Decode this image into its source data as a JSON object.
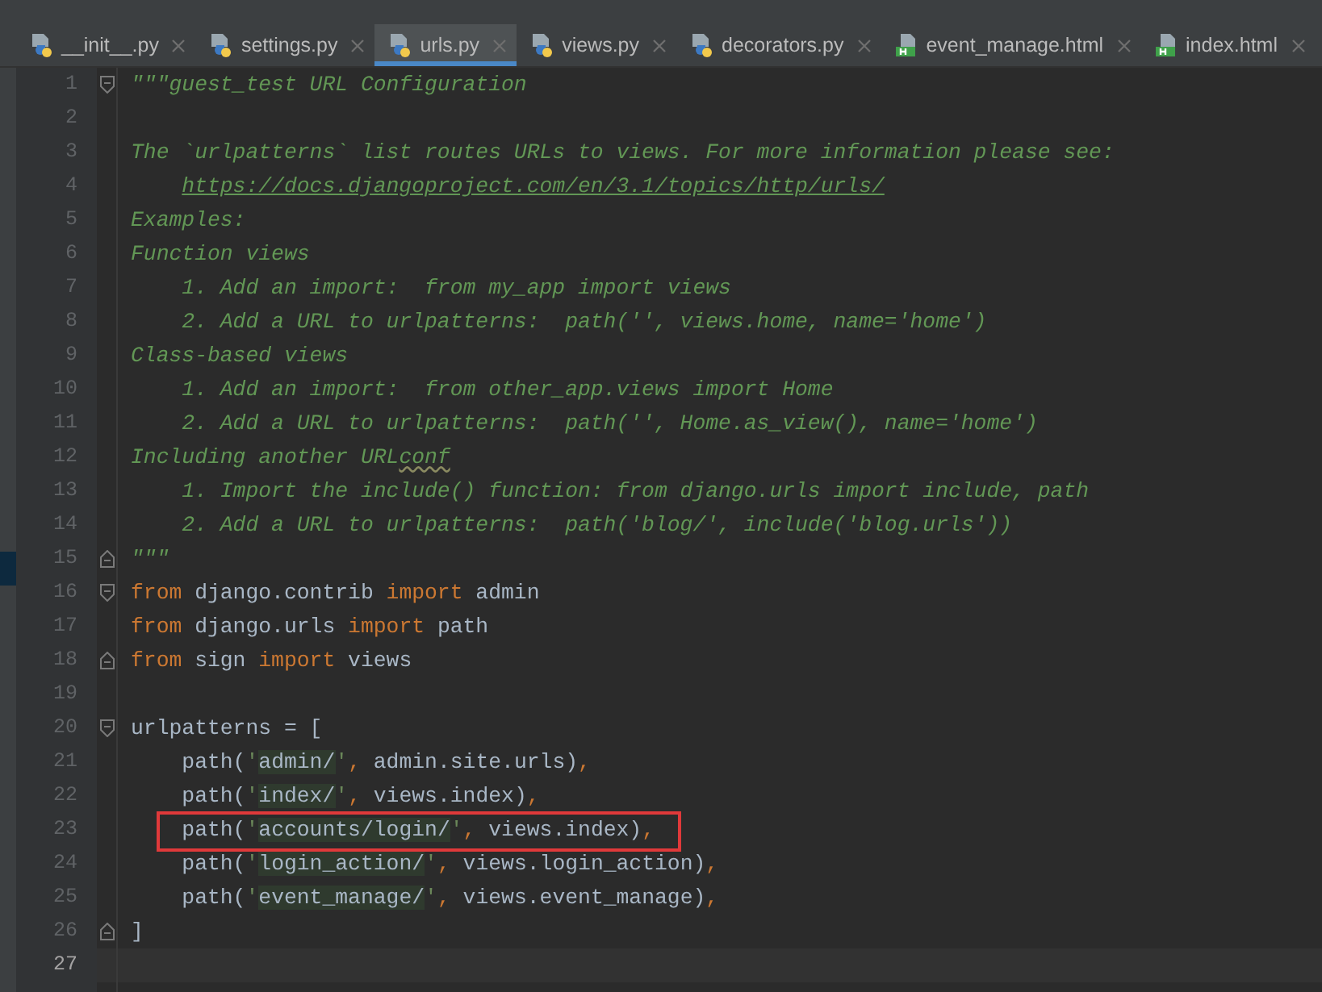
{
  "tabs": [
    {
      "label": "__init__.py",
      "kind": "python",
      "selected": false
    },
    {
      "label": "settings.py",
      "kind": "python",
      "selected": false
    },
    {
      "label": "urls.py",
      "kind": "python",
      "selected": true
    },
    {
      "label": "views.py",
      "kind": "python",
      "selected": false
    },
    {
      "label": "decorators.py",
      "kind": "python",
      "selected": false
    },
    {
      "label": "event_manage.html",
      "kind": "html",
      "selected": false
    },
    {
      "label": "index.html",
      "kind": "html",
      "selected": false
    }
  ],
  "editor": {
    "lines": [
      {
        "number": "1",
        "kind": "fold-start",
        "tokens": [
          {
            "kind": "doc",
            "text": "\"\"\"guest_test URL Configuration"
          }
        ]
      },
      {
        "number": "2",
        "kind": "plain"
      },
      {
        "number": "3",
        "kind": "plain",
        "tokens": [
          {
            "kind": "doc",
            "text": "The `urlpatterns` list routes URLs to views. For more information please see:"
          }
        ]
      },
      {
        "number": "4",
        "kind": "plain",
        "indented": true,
        "tokens": [
          {
            "kind": "link",
            "text": "https://docs.djangoproject.com/en/3.1/topics/http/urls/"
          }
        ]
      },
      {
        "number": "5",
        "kind": "plain",
        "tokens": [
          {
            "kind": "doc",
            "text": "Examples:"
          }
        ]
      },
      {
        "number": "6",
        "kind": "plain",
        "tokens": [
          {
            "kind": "doc",
            "text": "Function views"
          }
        ]
      },
      {
        "number": "7",
        "kind": "plain",
        "tokens": [
          {
            "kind": "doc",
            "text": "    1. Add an import:  from my_app import views"
          }
        ]
      },
      {
        "number": "8",
        "kind": "plain",
        "tokens": [
          {
            "kind": "doc",
            "text": "    2. Add a URL to urlpatterns:  path('', views.home, name='home')"
          }
        ]
      },
      {
        "number": "9",
        "kind": "plain",
        "tokens": [
          {
            "kind": "doc",
            "text": "Class-based views"
          }
        ]
      },
      {
        "number": "10",
        "kind": "plain",
        "tokens": [
          {
            "kind": "doc",
            "text": "    1. Add an import:  from other_app.views import Home"
          }
        ]
      },
      {
        "number": "11",
        "kind": "plain",
        "tokens": [
          {
            "kind": "doc",
            "text": "    2. Add a URL to urlpatterns:  path('', Home.as_view(), name='home')"
          }
        ]
      },
      {
        "number": "12",
        "kind": "plain",
        "tokens": [
          {
            "kind": "doc",
            "text": "Including another URL"
          },
          {
            "kind": "typo",
            "text": "conf"
          }
        ]
      },
      {
        "number": "13",
        "kind": "plain",
        "tokens": [
          {
            "kind": "doc",
            "text": "    1. Import the include() function: from django.urls import include, path"
          }
        ]
      },
      {
        "number": "14",
        "kind": "plain",
        "tokens": [
          {
            "kind": "doc",
            "text": "    2. Add a URL to urlpatterns:  path('blog/', include('blog.urls'))"
          }
        ]
      },
      {
        "number": "15",
        "kind": "fold-end",
        "tokens": [
          {
            "kind": "doc",
            "text": "\"\"\""
          }
        ]
      },
      {
        "number": "16",
        "kind": "fold-start",
        "tokens": [
          {
            "kind": "keyword",
            "text": "from"
          },
          {
            "kind": "plain",
            "text": " django.contrib "
          },
          {
            "kind": "keyword",
            "text": "import"
          },
          {
            "kind": "plain",
            "text": " admin"
          }
        ]
      },
      {
        "number": "17",
        "kind": "plain",
        "tokens": [
          {
            "kind": "keyword",
            "text": "from"
          },
          {
            "kind": "plain",
            "text": " django.urls "
          },
          {
            "kind": "keyword",
            "text": "import"
          },
          {
            "kind": "plain",
            "text": " path"
          }
        ]
      },
      {
        "number": "18",
        "kind": "fold-end",
        "tokens": [
          {
            "kind": "keyword",
            "text": "from"
          },
          {
            "kind": "plain",
            "text": " sign "
          },
          {
            "kind": "keyword",
            "text": "import"
          },
          {
            "kind": "plain",
            "text": " views"
          }
        ]
      },
      {
        "number": "19",
        "kind": "plain"
      },
      {
        "number": "20",
        "kind": "fold-start",
        "tokens": [
          {
            "kind": "plain",
            "text": "urlpatterns = ["
          }
        ]
      },
      {
        "number": "21",
        "kind": "plain",
        "tokens": [
          {
            "kind": "plain",
            "text": "    path("
          },
          {
            "kind": "quote",
            "text": "'"
          },
          {
            "kind": "string",
            "text": "admin/"
          },
          {
            "kind": "quote",
            "text": "'"
          },
          {
            "kind": "punct",
            "text": ","
          },
          {
            "kind": "plain",
            "text": " admin.site.urls)"
          },
          {
            "kind": "punct",
            "text": ","
          }
        ]
      },
      {
        "number": "22",
        "kind": "plain",
        "tokens": [
          {
            "kind": "plain",
            "text": "    path("
          },
          {
            "kind": "quote",
            "text": "'"
          },
          {
            "kind": "string",
            "text": "index/"
          },
          {
            "kind": "quote",
            "text": "'"
          },
          {
            "kind": "punct",
            "text": ","
          },
          {
            "kind": "plain",
            "text": " views.index)"
          },
          {
            "kind": "punct",
            "text": ","
          }
        ]
      },
      {
        "number": "23",
        "kind": "plain",
        "boxed": true,
        "tokens": [
          {
            "kind": "plain",
            "text": "    path("
          },
          {
            "kind": "quote",
            "text": "'"
          },
          {
            "kind": "string",
            "text": "accounts/login/"
          },
          {
            "kind": "quote",
            "text": "'"
          },
          {
            "kind": "punct",
            "text": ","
          },
          {
            "kind": "plain",
            "text": " views.index)"
          },
          {
            "kind": "punct",
            "text": ","
          }
        ]
      },
      {
        "number": "24",
        "kind": "plain",
        "tokens": [
          {
            "kind": "plain",
            "text": "    path("
          },
          {
            "kind": "quote",
            "text": "'"
          },
          {
            "kind": "string",
            "text": "login_action/"
          },
          {
            "kind": "quote",
            "text": "'"
          },
          {
            "kind": "punct",
            "text": ","
          },
          {
            "kind": "plain",
            "text": " views.login_action)"
          },
          {
            "kind": "punct",
            "text": ","
          }
        ]
      },
      {
        "number": "25",
        "kind": "plain",
        "tokens": [
          {
            "kind": "plain",
            "text": "    path("
          },
          {
            "kind": "quote",
            "text": "'"
          },
          {
            "kind": "string",
            "text": "event_manage/"
          },
          {
            "kind": "quote",
            "text": "'"
          },
          {
            "kind": "punct",
            "text": ","
          },
          {
            "kind": "plain",
            "text": " views.event_manage)"
          },
          {
            "kind": "punct",
            "text": ","
          }
        ]
      },
      {
        "number": "26",
        "kind": "fold-end",
        "tokens": [
          {
            "kind": "plain",
            "text": "]"
          }
        ]
      },
      {
        "number": "27",
        "kind": "plain",
        "current": true
      }
    ]
  }
}
